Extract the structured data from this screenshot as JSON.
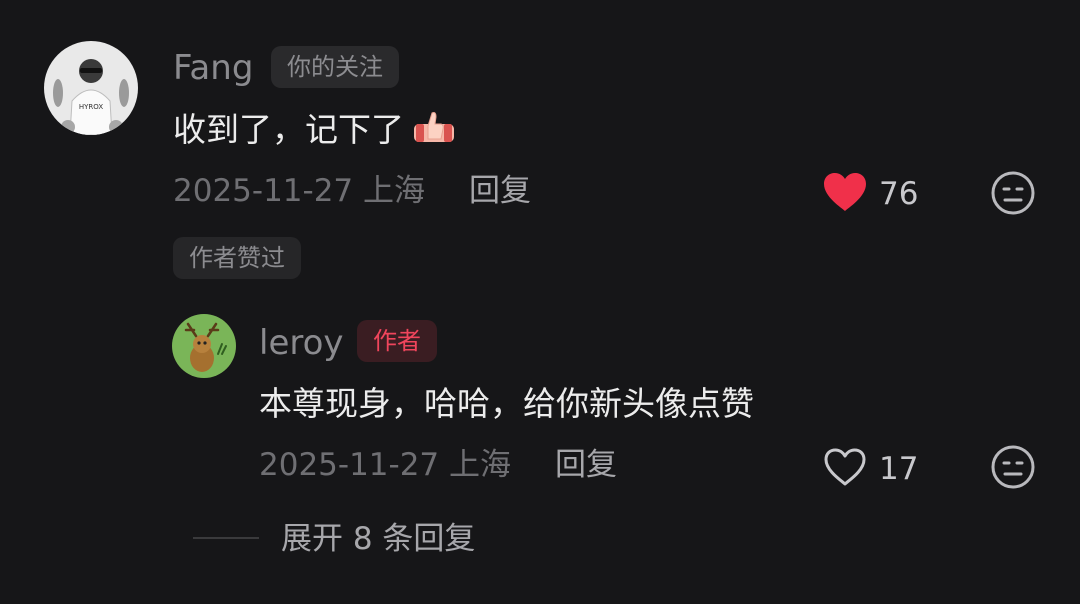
{
  "colors": {
    "background": "#161618",
    "like_active": "#f0304a",
    "author_tag_text": "#f0455c",
    "author_tag_bg": "#3a1d22"
  },
  "comment": {
    "avatar": "user-avatar-photo",
    "username": "Fang",
    "tag": "你的关注",
    "text": "收到了，记下了",
    "emoji": "thumbs-up-emoji",
    "time_location": "2025-11-27 上海",
    "reply_label": "回复",
    "likes": "76",
    "liked": true,
    "liked_by_author_badge": "作者赞过"
  },
  "reply": {
    "avatar": "deer-avatar",
    "username": "leroy",
    "tag": "作者",
    "text": "本尊现身，哈哈，给你新头像点赞",
    "time_location": "2025-11-27 上海",
    "reply_label": "回复",
    "likes": "17",
    "liked": false
  },
  "expand": {
    "label": "展开 8 条回复"
  }
}
